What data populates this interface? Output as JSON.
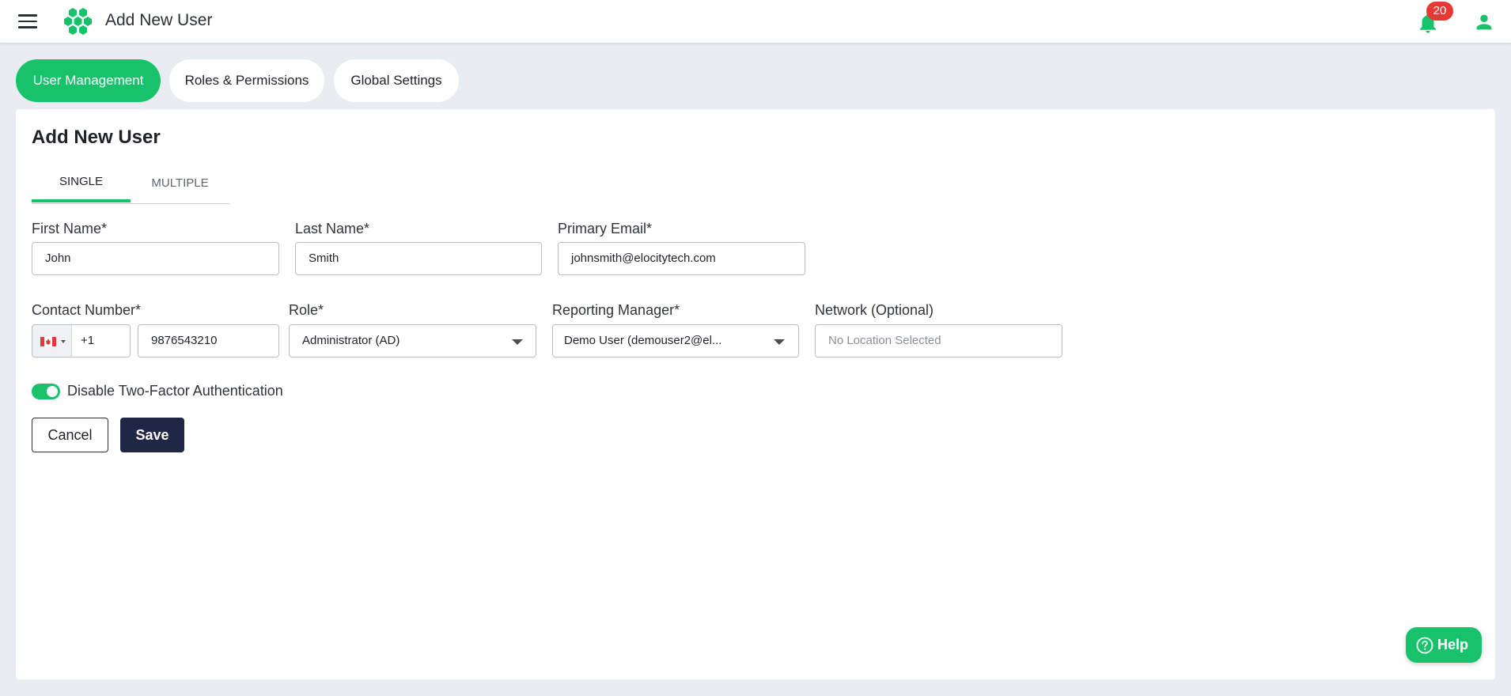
{
  "header": {
    "title": "Add New User",
    "notifications_count": "20",
    "brand_color": "#17c26b"
  },
  "section_tabs": [
    {
      "label": "User Management",
      "active": true
    },
    {
      "label": "Roles & Permissions",
      "active": false
    },
    {
      "label": "Global Settings",
      "active": false
    }
  ],
  "page": {
    "title": "Add New User",
    "subtabs": [
      {
        "label": "SINGLE",
        "active": true
      },
      {
        "label": "MULTIPLE",
        "active": false
      }
    ]
  },
  "form": {
    "first_name": {
      "label": "First Name*",
      "value": "John"
    },
    "last_name": {
      "label": "Last Name*",
      "value": "Smith"
    },
    "email": {
      "label": "Primary Email*",
      "value": "johnsmith@elocitytech.com"
    },
    "contact": {
      "label": "Contact Number*",
      "country_flag": "canada-flag-icon",
      "dial_code": "+1",
      "value": "9876543210"
    },
    "role": {
      "label": "Role*",
      "value": "Administrator (AD)"
    },
    "manager": {
      "label": "Reporting Manager*",
      "value": "Demo User (demouser2@el..."
    },
    "network": {
      "label": "Network (Optional)",
      "placeholder": "No Location Selected"
    },
    "two_factor": {
      "label": "Disable Two-Factor Authentication",
      "enabled": true
    }
  },
  "actions": {
    "cancel": "Cancel",
    "save": "Save"
  },
  "help": {
    "label": "Help"
  },
  "colors": {
    "accent": "#17c26b",
    "save_button": "#1f2744",
    "badge": "#e53935",
    "background": "#e9ecf1"
  }
}
